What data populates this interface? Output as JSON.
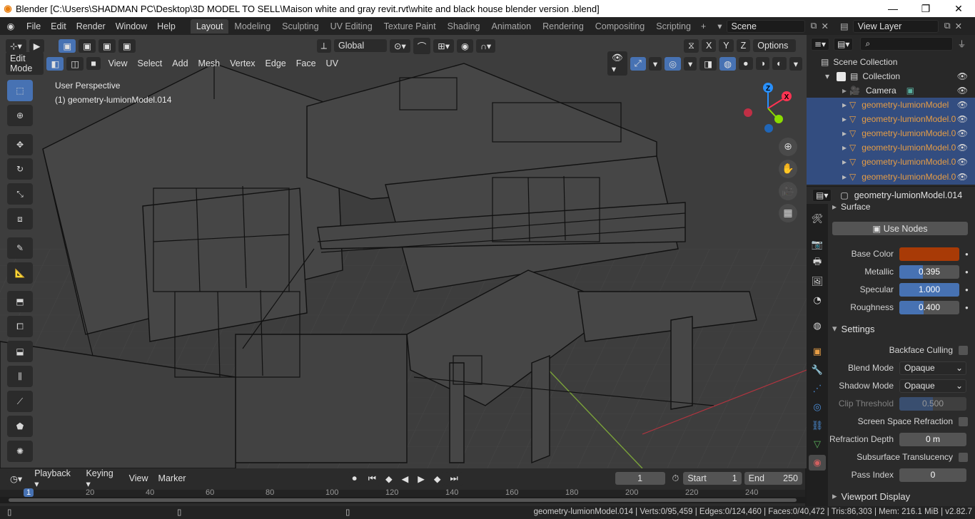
{
  "titlebar": {
    "title": "Blender [C:\\Users\\SHADMAN PC\\Desktop\\3D MODEL TO SELL\\Maison white and gray revit.rvt\\white and black house blender version .blend]",
    "minimize": "—",
    "maximize": "❐",
    "close": "✕"
  },
  "menu": [
    "File",
    "Edit",
    "Render",
    "Window",
    "Help"
  ],
  "workspaces": [
    "Layout",
    "Modeling",
    "Sculpting",
    "UV Editing",
    "Texture Paint",
    "Shading",
    "Animation",
    "Rendering",
    "Compositing",
    "Scripting"
  ],
  "scene": {
    "name": "Scene",
    "view_layer": "View Layer"
  },
  "viewport": {
    "orientation": "Global",
    "options": "Options",
    "mode": "Edit Mode",
    "menus": [
      "View",
      "Select",
      "Add",
      "Mesh",
      "Vertex",
      "Edge",
      "Face",
      "UV"
    ],
    "perspective": "User Perspective",
    "object": "(1) geometry-lumionModel.014",
    "axes": {
      "x": "X",
      "y": "Y",
      "z": "Z"
    },
    "gizmo": {
      "x": "X",
      "y": "Y",
      "z": "Z"
    }
  },
  "outliner": {
    "scene_collection": "Scene Collection",
    "collection": "Collection",
    "camera": "Camera",
    "objects": [
      "geometry-lumionModel",
      "geometry-lumionModel.0",
      "geometry-lumionModel.0",
      "geometry-lumionModel.0",
      "geometry-lumionModel.0",
      "geometry-lumionModel.0"
    ]
  },
  "properties": {
    "object_name": "geometry-lumionModel.014",
    "surface": "Surface",
    "use_nodes": "Use Nodes",
    "base_color_label": "Base Color",
    "base_color": "#a83a06",
    "metallic_label": "Metallic",
    "metallic": "0.395",
    "specular_label": "Specular",
    "specular": "1.000",
    "roughness_label": "Roughness",
    "roughness": "0.400",
    "settings": "Settings",
    "backface_culling": "Backface Culling",
    "blend_mode_label": "Blend Mode",
    "blend_mode": "Opaque",
    "shadow_mode_label": "Shadow Mode",
    "shadow_mode": "Opaque",
    "clip_threshold_label": "Clip Threshold",
    "clip_threshold": "0.500",
    "ssr_label": "Screen Space Refraction",
    "refraction_depth_label": "Refraction Depth",
    "refraction_depth": "0 m",
    "subsurface_label": "Subsurface Translucency",
    "pass_index_label": "Pass Index",
    "pass_index": "0",
    "viewport_display": "Viewport Display"
  },
  "timeline": {
    "menus": [
      "Playback",
      "Keying",
      "View",
      "Marker"
    ],
    "current_frame": "1",
    "start_label": "Start",
    "start": "1",
    "end_label": "End",
    "end": "250",
    "ruler": [
      "1",
      "20",
      "40",
      "60",
      "80",
      "100",
      "120",
      "140",
      "160",
      "180",
      "200",
      "220",
      "240"
    ]
  },
  "statusbar": {
    "text": "geometry-lumionModel.014 | Verts:0/95,459 | Edges:0/124,460 | Faces:0/40,472 | Tris:86,303 | Mem: 216.1 MiB | v2.82.7"
  },
  "colors": {
    "accent": "#4772b3",
    "selected_row": "#334d80",
    "object_orange": "#e59c45",
    "x_axis": "#ff3352",
    "y_axis": "#8bdc00",
    "z_axis": "#2890ff"
  }
}
